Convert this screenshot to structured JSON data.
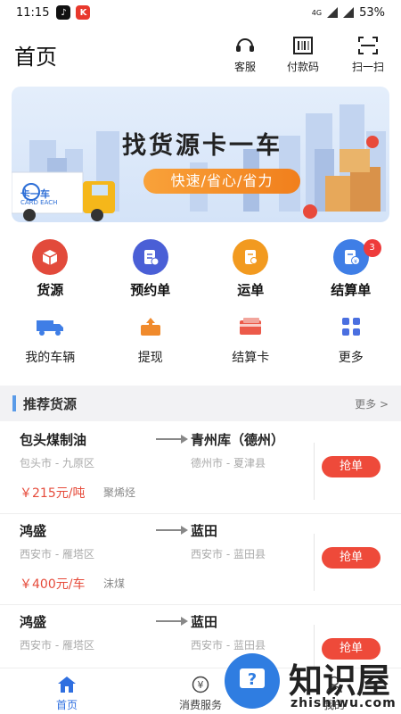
{
  "status_bar": {
    "time": "11:15",
    "battery": "53%",
    "network": "4G"
  },
  "header": {
    "title": "首页",
    "buttons": [
      {
        "label": "客服",
        "icon": "headset-icon"
      },
      {
        "label": "付款码",
        "icon": "barcode-icon"
      },
      {
        "label": "扫一扫",
        "icon": "scan-icon"
      }
    ]
  },
  "banner": {
    "slogan": "找货源卡一车",
    "tagline": "快速/省心/省力",
    "truck_brand": "卡一车",
    "truck_brand_en": "CARD EACH"
  },
  "quick_menu": [
    {
      "label": "货源",
      "icon": "cargo-box-icon",
      "color": "#e24a3b"
    },
    {
      "label": "预约单",
      "icon": "reservation-doc-icon",
      "color": "#4a5fd6"
    },
    {
      "label": "运单",
      "icon": "waybill-icon",
      "color": "#f29a1f"
    },
    {
      "label": "结算单",
      "icon": "settlement-doc-icon",
      "color": "#3f7ee6",
      "badge": "3"
    }
  ],
  "secondary_menu": [
    {
      "label": "我的车辆",
      "icon": "truck-icon"
    },
    {
      "label": "提现",
      "icon": "withdraw-icon"
    },
    {
      "label": "结算卡",
      "icon": "card-icon"
    },
    {
      "label": "更多",
      "icon": "grid-icon"
    }
  ],
  "section": {
    "title": "推荐货源",
    "more": "更多 >"
  },
  "cargo_list": [
    {
      "from": "包头煤制油",
      "from_city": "包头市 - 九原区",
      "to": "青州库（德州）",
      "to_city": "德州市 - 夏津县",
      "price": "￥215元/吨",
      "cargo": "聚烯烃",
      "action": "抢单"
    },
    {
      "from": "鸿盛",
      "from_city": "西安市 - 雁塔区",
      "to": "蓝田",
      "to_city": "西安市 - 蓝田县",
      "price": "￥400元/车",
      "cargo": "沫煤",
      "action": "抢单"
    },
    {
      "from": "鸿盛",
      "from_city": "西安市 - 雁塔区",
      "to": "蓝田",
      "to_city": "西安市 - 蓝田县",
      "price": "",
      "cargo": "",
      "action": "抢单"
    }
  ],
  "tab_bar": [
    {
      "label": "首页",
      "icon": "home-icon",
      "active": true
    },
    {
      "label": "消费服务",
      "icon": "yen-coin-icon",
      "active": false
    },
    {
      "label": "我的",
      "icon": "user-icon",
      "active": false
    }
  ],
  "watermark": {
    "text": "知识屋",
    "url": "zhishiwu.com"
  }
}
